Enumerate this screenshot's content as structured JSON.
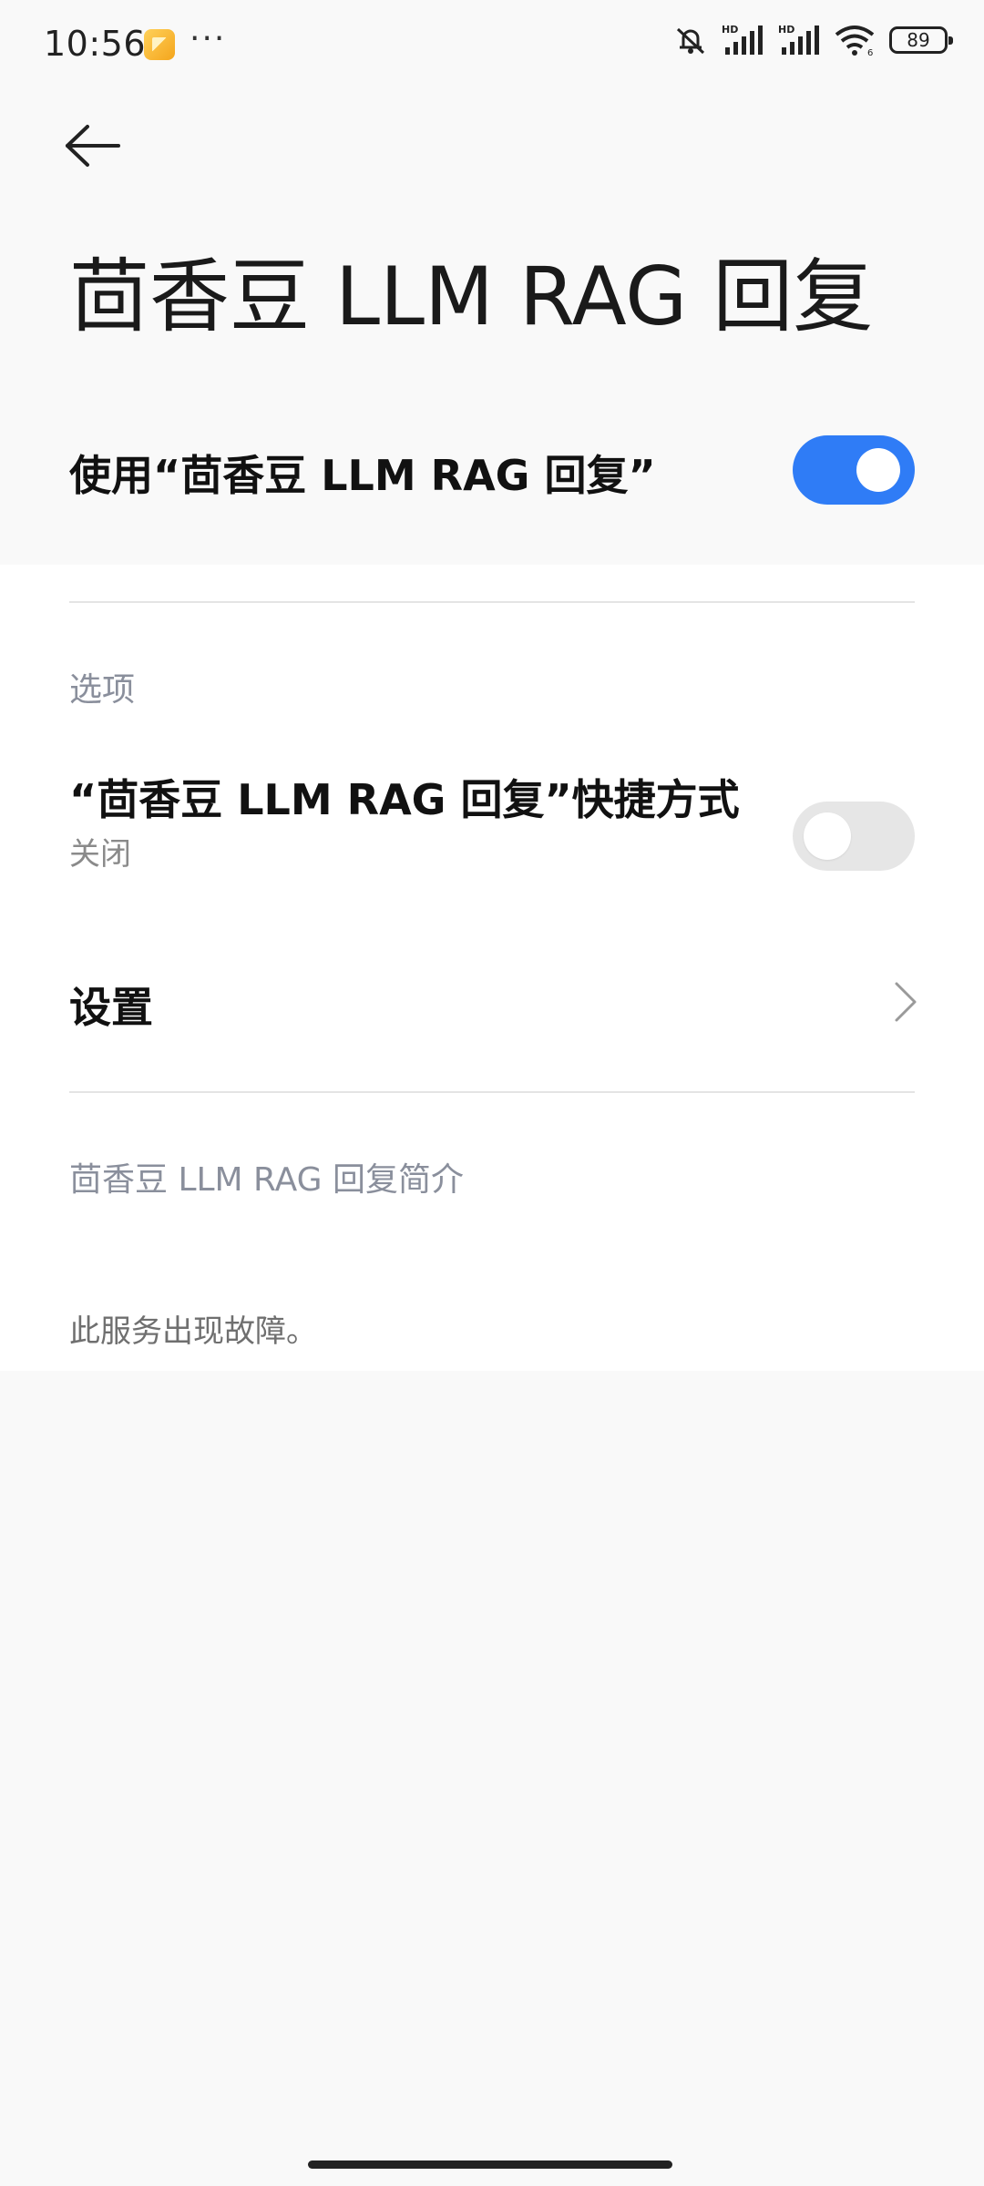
{
  "status_bar": {
    "time": "10:56",
    "more_indicator": "···",
    "battery_level": "89",
    "icons": [
      "app-notification-icon",
      "mute-icon",
      "hd-signal-icon",
      "hd-signal-icon",
      "wifi-icon",
      "battery-icon"
    ]
  },
  "header": {
    "back_icon": "arrow-left-icon",
    "title": "茴香豆 LLM RAG 回复"
  },
  "master_switch": {
    "label": "使用“茴香豆 LLM RAG 回复”",
    "enabled": true
  },
  "options": {
    "section_label": "选项",
    "shortcut": {
      "title": "“茴香豆 LLM RAG 回复”快捷方式",
      "subtitle": "关闭",
      "enabled": false
    },
    "settings": {
      "title": "设置",
      "icon": "chevron-right-icon"
    }
  },
  "about": {
    "section_label": "茴香豆 LLM RAG 回复简介",
    "description": "此服务出现故障。"
  },
  "colors": {
    "accent": "#2f7cf6",
    "background": "#f9f9f9",
    "card": "#ffffff",
    "toggle_off": "#e6e6e6",
    "section_text": "#8a8f9c"
  }
}
